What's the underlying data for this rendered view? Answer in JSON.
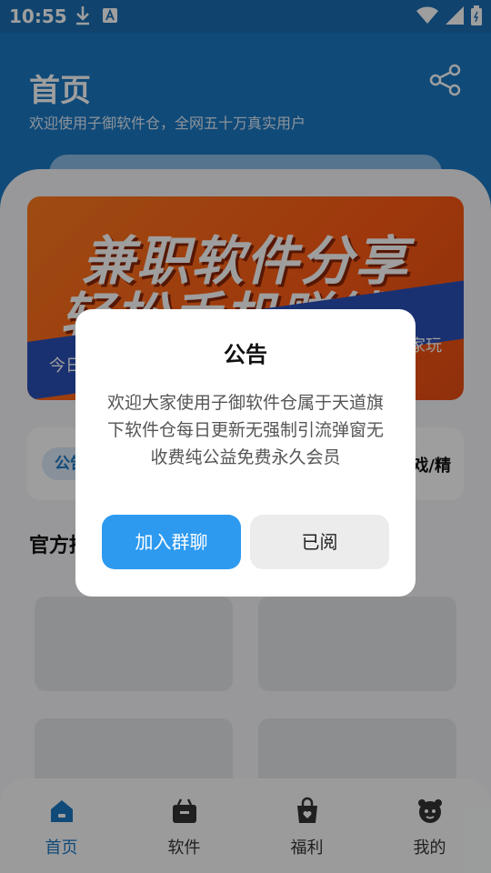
{
  "status_bar": {
    "time": "10:55"
  },
  "header": {
    "title": "首页",
    "subtitle": "欢迎使用子御软件仓，全网五十万真实用户"
  },
  "banner": {
    "line1": "兼职软件分享",
    "line2": "轻松手机赚钱",
    "ribbon_left": "今日",
    "ribbon_right": "家玩"
  },
  "notice": {
    "tag": "公告",
    "text": "戏/精"
  },
  "section": {
    "title": "官方推荐"
  },
  "dialog": {
    "title": "公告",
    "body": "欢迎大家使用子御软件仓属于天道旗下软件仓每日更新无强制引流弹窗无收费纯公益免费永久会员",
    "primary_button": "加入群聊",
    "secondary_button": "已阅"
  },
  "bottom_nav": {
    "items": [
      {
        "label": "首页",
        "icon": "home-icon",
        "active": true
      },
      {
        "label": "软件",
        "icon": "software-icon",
        "active": false
      },
      {
        "label": "福利",
        "icon": "gift-bag-icon",
        "active": false
      },
      {
        "label": "我的",
        "icon": "profile-icon",
        "active": false
      }
    ]
  },
  "colors": {
    "primary": "#1a78c2",
    "button_blue": "#2d9af0",
    "banner_orange": "#ff5a14"
  }
}
